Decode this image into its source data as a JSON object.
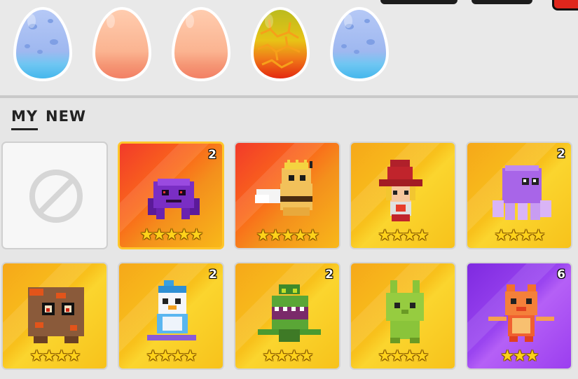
{
  "eggs": [
    {
      "name": "blue-egg",
      "top": "#a7c6f4",
      "bottom": "#55bff0",
      "spots": "#7ea2e6"
    },
    {
      "name": "peach-egg",
      "top": "#ffc4a4",
      "bottom": "#f7946f",
      "spots": "#f5a887"
    },
    {
      "name": "peach-egg",
      "top": "#ffc4a4",
      "bottom": "#f7946f",
      "spots": "#f5a887"
    },
    {
      "name": "lava-egg",
      "top": "#c9c21f",
      "bottom": "#e52c12",
      "spots": "#f0861a"
    },
    {
      "name": "blue-egg",
      "top": "#a7c6f4",
      "bottom": "#55bff0",
      "spots": "#7ea2e6"
    }
  ],
  "tabs": {
    "my": "MY",
    "new": "NEW"
  },
  "cards": [
    {
      "id": "empty-slot",
      "style": "empty",
      "count": "",
      "stars": 0,
      "icon": "no-entry-icon"
    },
    {
      "id": "purple-spider",
      "style": "red",
      "count": "2",
      "stars": 5,
      "icon": "spider-pet-icon"
    },
    {
      "id": "queen-bee",
      "style": "red",
      "count": "",
      "stars": 5,
      "icon": "bee-pet-icon"
    },
    {
      "id": "red-wizard",
      "style": "gold",
      "count": "",
      "stars": 4,
      "icon": "wizard-pet-icon"
    },
    {
      "id": "purple-octopus",
      "style": "gold",
      "count": "2",
      "stars": 4,
      "icon": "octopus-pet-icon"
    },
    {
      "id": "magma-golem",
      "style": "gold",
      "count": "",
      "stars": 4,
      "icon": "golem-pet-icon"
    },
    {
      "id": "snowboard-penguin",
      "style": "gold",
      "count": "2",
      "stars": 4,
      "icon": "penguin-pet-icon"
    },
    {
      "id": "venus-flytrap",
      "style": "gold",
      "count": "2",
      "stars": 4,
      "icon": "plant-pet-icon"
    },
    {
      "id": "green-bunny",
      "style": "gold",
      "count": "",
      "stars": 4,
      "icon": "bunny-pet-icon"
    },
    {
      "id": "fire-dragon",
      "style": "purple",
      "count": "6",
      "stars": 3,
      "icon": "dragon-pet-icon"
    }
  ],
  "colors": {
    "accent_selected": "#ffc62b",
    "star": "#ffd21a"
  }
}
